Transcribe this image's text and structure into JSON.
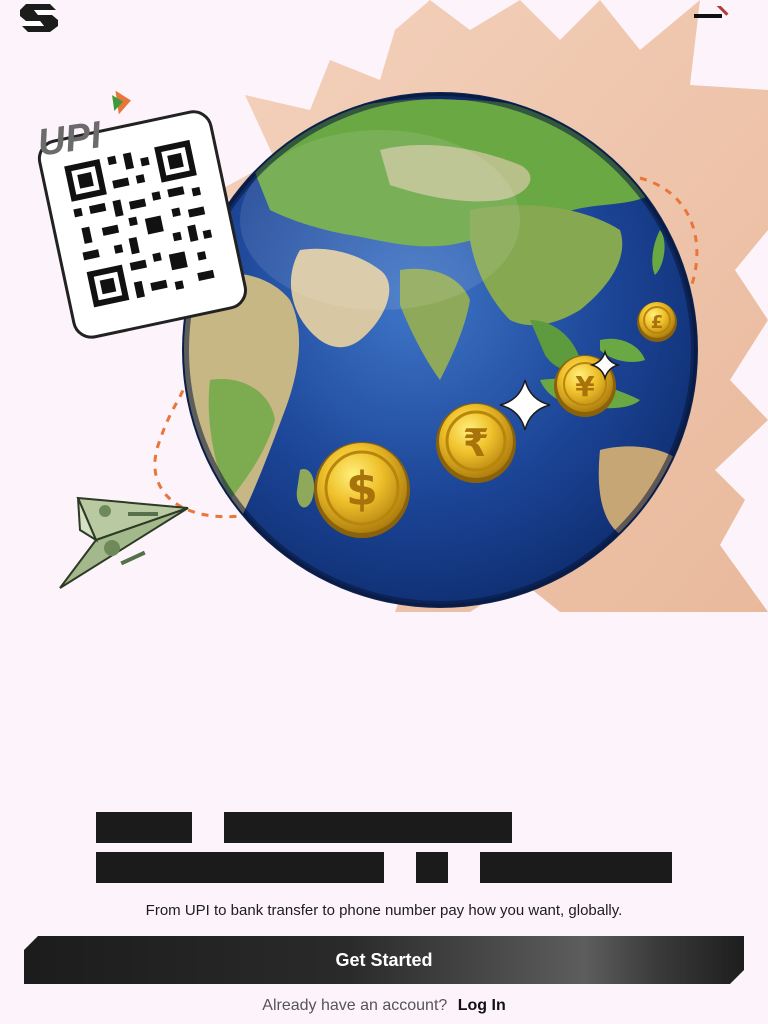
{
  "header": {
    "logo_icon": "s-brand-logo-icon",
    "menu_icon": "hamburger-menu-icon"
  },
  "hero": {
    "upi_text": "UPI",
    "coin_icons": [
      "dollar-coin-icon",
      "rupee-coin-icon",
      "yen-coin-icon",
      "pound-coin-icon"
    ],
    "illustration": [
      "qr-code-icon",
      "globe-illustration",
      "paper-plane-money-icon"
    ]
  },
  "content": {
    "subtitle": "From UPI to bank transfer to phone number pay how you want, globally."
  },
  "actions": {
    "primary_label": "Get Started",
    "account_prompt": "Already have an account?",
    "login_label": "Log In"
  },
  "colors": {
    "background": "#fdf4fb",
    "button_dark": "#1c1c1c",
    "accent_orange": "#e8763a",
    "paper_burst": "#f1c7ad",
    "coin_gold": "#e9b825"
  }
}
